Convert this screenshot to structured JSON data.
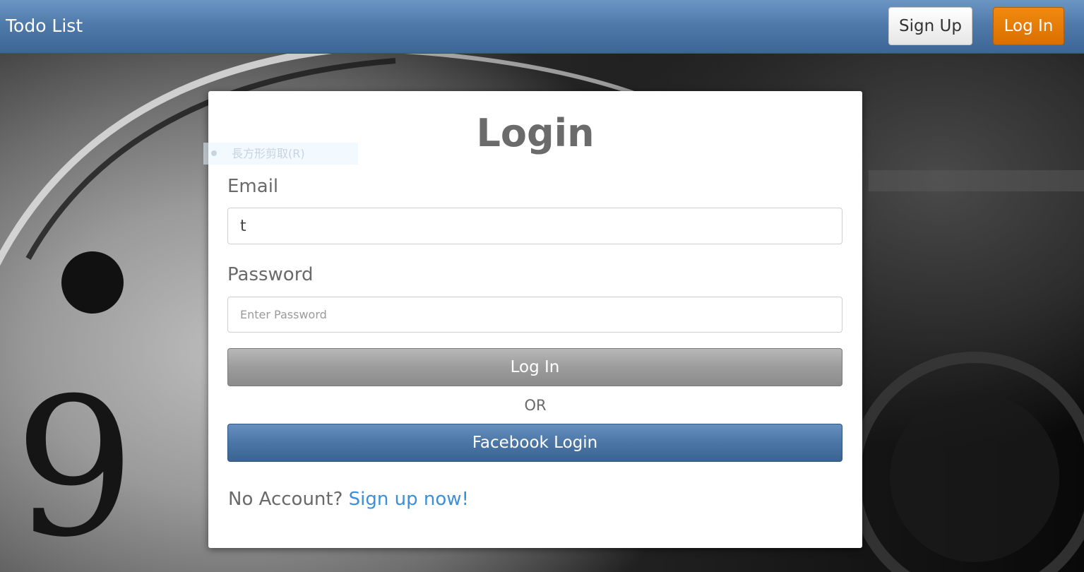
{
  "navbar": {
    "brand": "Todo List",
    "signup_label": "Sign Up",
    "login_label": "Log In"
  },
  "login_card": {
    "title": "Login",
    "email_label": "Email",
    "email_value": "t",
    "password_label": "Password",
    "password_placeholder": "Enter Password",
    "login_button": "Log In",
    "or_text": "OR",
    "facebook_button": "Facebook Login",
    "no_account_text": "No Account?",
    "signup_link": "Sign up now!"
  },
  "context_menu_ghost": {
    "label": "長方形剪取(R)"
  },
  "colors": {
    "navbar": "#4f7aaa",
    "login_accent": "#e07800",
    "link": "#3d8fd9",
    "facebook": "#4b76a6"
  }
}
